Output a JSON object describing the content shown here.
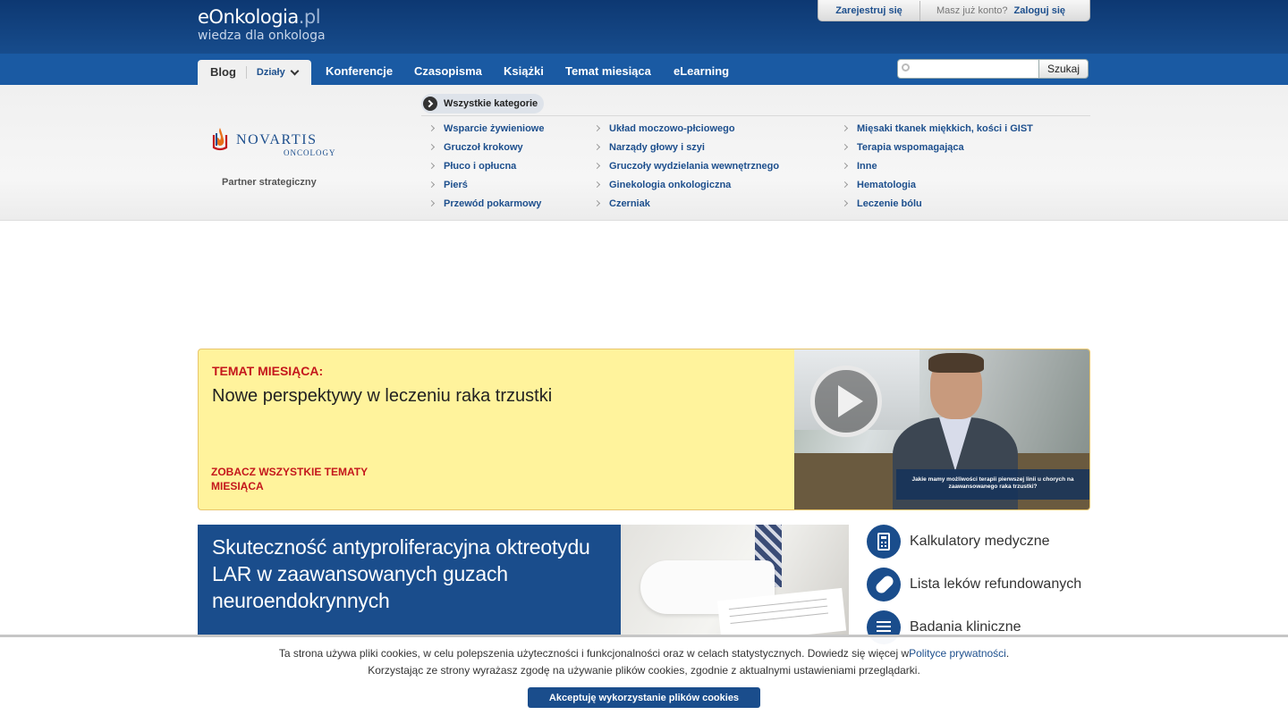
{
  "header": {
    "logo_main": "eOnkologia",
    "logo_tld": ".pl",
    "logo_tagline": "wiedza dla onkologa",
    "register_label": "Zarejestruj się",
    "have_account_label": "Masz już konto?",
    "login_label": "Zaloguj się"
  },
  "nav": {
    "blog_label": "Blog",
    "sections_label": "Działy",
    "items": [
      {
        "label": "Konferencje"
      },
      {
        "label": "Czasopisma"
      },
      {
        "label": "Książki"
      },
      {
        "label": "Temat miesiąca"
      },
      {
        "label": "eLearning"
      }
    ],
    "search_placeholder": "",
    "search_button": "Szukaj"
  },
  "partner": {
    "logo_name": "NOVARTIS",
    "logo_division": "ONCOLOGY",
    "caption": "Partner strategiczny"
  },
  "categories": {
    "all_label": "Wszystkie kategorie",
    "columns": [
      [
        "Wsparcie żywieniowe",
        "Gruczoł krokowy",
        "Płuco i opłucna",
        "Pierś",
        "Przewód pokarmowy"
      ],
      [
        "Układ moczowo-płciowego",
        "Narządy głowy i szyi",
        "Gruczoły wydzielania wewnętrznego",
        "Ginekologia onkologiczna",
        "Czerniak"
      ],
      [
        "Mięsaki tkanek miękkich, kości i GIST",
        "Terapia wspomagająca",
        "Inne",
        "Hematologia",
        "Leczenie bólu"
      ]
    ]
  },
  "topic_of_month": {
    "label": "TEMAT MIESIĄCA:",
    "title": "Nowe perspektywy w leczeniu raka trzustki",
    "see_all": "ZOBACZ WSZYSTKIE TEMATY MIESIĄCA",
    "video_caption": "Jakie mamy możliwości terapii pierwszej linii u chorych na zaawansowanego raka trzustki?"
  },
  "feature": {
    "title": "Skuteczność antyproliferacyjna oktreotydu LAR w zaawansowanych guzach neuroendokrynnych"
  },
  "quick_links": [
    {
      "label": "Kalkulatory medyczne",
      "icon": "calculator-icon"
    },
    {
      "label": "Lista leków refundowanych",
      "icon": "pill-icon"
    },
    {
      "label": "Badania kliniczne",
      "icon": "list-icon"
    }
  ],
  "cookies": {
    "line1": "Ta strona używa pliki cookies, w celu polepszenia użyteczności i funkcjonalności oraz w celach statystycznych. Dowiedz się więcej w",
    "policy_link": "Polityce prywatności",
    "line1_end": ".",
    "line2": "Korzystając ze strony wyrażasz zgodę na używanie plików cookies, zgodnie z aktualnymi ustawieniami przeglądarki.",
    "accept_button": "Akceptuję wykorzystanie plików cookies"
  },
  "colors": {
    "header_dark": "#0d3872",
    "nav_blue": "#1a5aa3",
    "link_blue": "#1d4f8d",
    "topic_bg": "#fff39c",
    "topic_red": "#c4171c"
  }
}
